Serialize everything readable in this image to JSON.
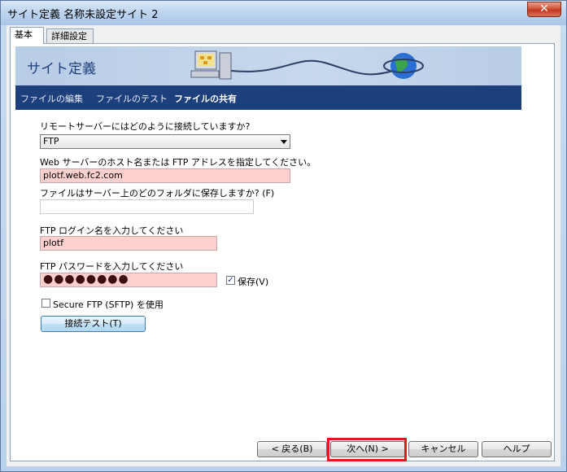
{
  "window": {
    "title": "サイト定義 名称未設定サイト 2",
    "close_label": "✕"
  },
  "tabs": [
    {
      "label": "基本",
      "active": true
    },
    {
      "label": "詳細設定",
      "active": false
    }
  ],
  "banner": {
    "title": "サイト定義"
  },
  "nav": [
    {
      "label": "ファイルの編集",
      "active": false
    },
    {
      "label": "ファイルのテスト",
      "active": false
    },
    {
      "label": "ファイルの共有",
      "active": true
    }
  ],
  "form": {
    "connect_label": "リモートサーバーにはどのように接続していますか?",
    "connect_value": "FTP",
    "host_label": "Web サーバーのホスト名または FTP アドレスを指定してください。",
    "host_value": "plotf.web.fc2.com",
    "folder_label": "ファイルはサーバー上のどのフォルダに保存しますか? (F)",
    "folder_value": "",
    "login_label": "FTP ログイン名を入力してください",
    "login_value": "plotf",
    "password_label": "FTP パスワードを入力してください",
    "password_dots": "●●●●●●●●",
    "save_label": "保存(V)",
    "save_checked": true,
    "sftp_label": "Secure FTP (SFTP) を使用",
    "sftp_checked": false,
    "test_button": "接続テスト(T)"
  },
  "footer": {
    "back": "< 戻る(B)",
    "next": "次へ(N) >",
    "cancel": "キャンセル",
    "help": "ヘルプ"
  },
  "colors": {
    "nav_bg": "#1d3f7c",
    "field_highlight": "#fdd0d0",
    "annotation_box": "#e8141e"
  }
}
